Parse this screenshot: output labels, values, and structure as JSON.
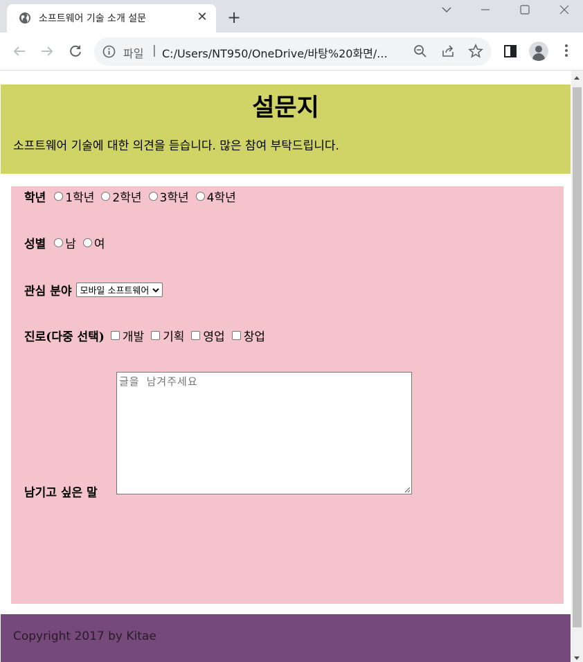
{
  "browser": {
    "tab_title": "소프트웨어 기술 소개 설문",
    "new_tab_label": "+",
    "close_label": "✕",
    "file_label": "파일",
    "url_separator": "|",
    "url": "C:/Users/NT950/OneDrive/바탕%20화면/..."
  },
  "header": {
    "title": "설문지",
    "description": "소프트웨어 기술에 대한 의견을 듣습니다. 많은 참여 부탁드립니다."
  },
  "form": {
    "grade": {
      "label": "학년",
      "options": [
        "1학년",
        "2학년",
        "3학년",
        "4학년"
      ]
    },
    "gender": {
      "label": "성별",
      "options": [
        "남",
        "여"
      ]
    },
    "interest": {
      "label": "관심 분야",
      "selected": "모바일 소프트웨어"
    },
    "career": {
      "label": "진로(다중 선택)",
      "options": [
        "개발",
        "기획",
        "영업",
        "창업"
      ]
    },
    "comment": {
      "label": "남기고 싶은 말",
      "placeholder": "글을 남겨주세요"
    }
  },
  "footer": {
    "text": "Copyright 2017 by Kitae"
  },
  "colors": {
    "header_bg": "#d0d466",
    "form_bg": "#f4c3cb",
    "footer_bg": "#754a7a"
  }
}
